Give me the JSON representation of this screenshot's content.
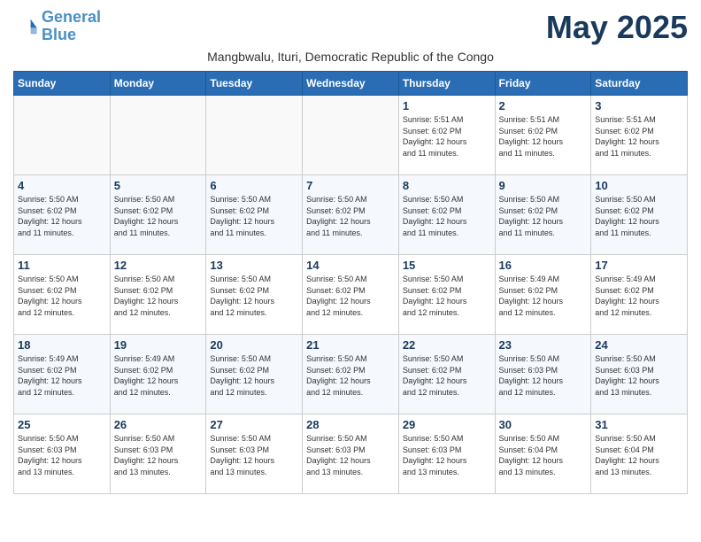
{
  "logo": {
    "line1": "General",
    "line2": "Blue"
  },
  "month_title": "May 2025",
  "subtitle": "Mangbwalu, Ituri, Democratic Republic of the Congo",
  "days_of_week": [
    "Sunday",
    "Monday",
    "Tuesday",
    "Wednesday",
    "Thursday",
    "Friday",
    "Saturday"
  ],
  "weeks": [
    [
      {
        "day": "",
        "info": ""
      },
      {
        "day": "",
        "info": ""
      },
      {
        "day": "",
        "info": ""
      },
      {
        "day": "",
        "info": ""
      },
      {
        "day": "1",
        "info": "Sunrise: 5:51 AM\nSunset: 6:02 PM\nDaylight: 12 hours\nand 11 minutes."
      },
      {
        "day": "2",
        "info": "Sunrise: 5:51 AM\nSunset: 6:02 PM\nDaylight: 12 hours\nand 11 minutes."
      },
      {
        "day": "3",
        "info": "Sunrise: 5:51 AM\nSunset: 6:02 PM\nDaylight: 12 hours\nand 11 minutes."
      }
    ],
    [
      {
        "day": "4",
        "info": "Sunrise: 5:50 AM\nSunset: 6:02 PM\nDaylight: 12 hours\nand 11 minutes."
      },
      {
        "day": "5",
        "info": "Sunrise: 5:50 AM\nSunset: 6:02 PM\nDaylight: 12 hours\nand 11 minutes."
      },
      {
        "day": "6",
        "info": "Sunrise: 5:50 AM\nSunset: 6:02 PM\nDaylight: 12 hours\nand 11 minutes."
      },
      {
        "day": "7",
        "info": "Sunrise: 5:50 AM\nSunset: 6:02 PM\nDaylight: 12 hours\nand 11 minutes."
      },
      {
        "day": "8",
        "info": "Sunrise: 5:50 AM\nSunset: 6:02 PM\nDaylight: 12 hours\nand 11 minutes."
      },
      {
        "day": "9",
        "info": "Sunrise: 5:50 AM\nSunset: 6:02 PM\nDaylight: 12 hours\nand 11 minutes."
      },
      {
        "day": "10",
        "info": "Sunrise: 5:50 AM\nSunset: 6:02 PM\nDaylight: 12 hours\nand 11 minutes."
      }
    ],
    [
      {
        "day": "11",
        "info": "Sunrise: 5:50 AM\nSunset: 6:02 PM\nDaylight: 12 hours\nand 12 minutes."
      },
      {
        "day": "12",
        "info": "Sunrise: 5:50 AM\nSunset: 6:02 PM\nDaylight: 12 hours\nand 12 minutes."
      },
      {
        "day": "13",
        "info": "Sunrise: 5:50 AM\nSunset: 6:02 PM\nDaylight: 12 hours\nand 12 minutes."
      },
      {
        "day": "14",
        "info": "Sunrise: 5:50 AM\nSunset: 6:02 PM\nDaylight: 12 hours\nand 12 minutes."
      },
      {
        "day": "15",
        "info": "Sunrise: 5:50 AM\nSunset: 6:02 PM\nDaylight: 12 hours\nand 12 minutes."
      },
      {
        "day": "16",
        "info": "Sunrise: 5:49 AM\nSunset: 6:02 PM\nDaylight: 12 hours\nand 12 minutes."
      },
      {
        "day": "17",
        "info": "Sunrise: 5:49 AM\nSunset: 6:02 PM\nDaylight: 12 hours\nand 12 minutes."
      }
    ],
    [
      {
        "day": "18",
        "info": "Sunrise: 5:49 AM\nSunset: 6:02 PM\nDaylight: 12 hours\nand 12 minutes."
      },
      {
        "day": "19",
        "info": "Sunrise: 5:49 AM\nSunset: 6:02 PM\nDaylight: 12 hours\nand 12 minutes."
      },
      {
        "day": "20",
        "info": "Sunrise: 5:50 AM\nSunset: 6:02 PM\nDaylight: 12 hours\nand 12 minutes."
      },
      {
        "day": "21",
        "info": "Sunrise: 5:50 AM\nSunset: 6:02 PM\nDaylight: 12 hours\nand 12 minutes."
      },
      {
        "day": "22",
        "info": "Sunrise: 5:50 AM\nSunset: 6:02 PM\nDaylight: 12 hours\nand 12 minutes."
      },
      {
        "day": "23",
        "info": "Sunrise: 5:50 AM\nSunset: 6:03 PM\nDaylight: 12 hours\nand 12 minutes."
      },
      {
        "day": "24",
        "info": "Sunrise: 5:50 AM\nSunset: 6:03 PM\nDaylight: 12 hours\nand 13 minutes."
      }
    ],
    [
      {
        "day": "25",
        "info": "Sunrise: 5:50 AM\nSunset: 6:03 PM\nDaylight: 12 hours\nand 13 minutes."
      },
      {
        "day": "26",
        "info": "Sunrise: 5:50 AM\nSunset: 6:03 PM\nDaylight: 12 hours\nand 13 minutes."
      },
      {
        "day": "27",
        "info": "Sunrise: 5:50 AM\nSunset: 6:03 PM\nDaylight: 12 hours\nand 13 minutes."
      },
      {
        "day": "28",
        "info": "Sunrise: 5:50 AM\nSunset: 6:03 PM\nDaylight: 12 hours\nand 13 minutes."
      },
      {
        "day": "29",
        "info": "Sunrise: 5:50 AM\nSunset: 6:03 PM\nDaylight: 12 hours\nand 13 minutes."
      },
      {
        "day": "30",
        "info": "Sunrise: 5:50 AM\nSunset: 6:04 PM\nDaylight: 12 hours\nand 13 minutes."
      },
      {
        "day": "31",
        "info": "Sunrise: 5:50 AM\nSunset: 6:04 PM\nDaylight: 12 hours\nand 13 minutes."
      }
    ]
  ]
}
